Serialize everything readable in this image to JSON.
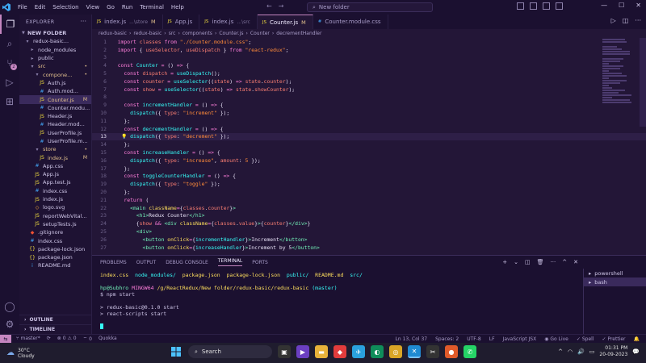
{
  "titlebar": {
    "menu": [
      "File",
      "Edit",
      "Selection",
      "View",
      "Go",
      "Run",
      "Terminal",
      "Help"
    ],
    "search": "New folder"
  },
  "sidebar": {
    "header": "EXPLORER",
    "root": "NEW FOLDER",
    "items": [
      {
        "label": "redux-basic...",
        "indent": 1,
        "type": "folder-open",
        "mark": "",
        "cls": ""
      },
      {
        "label": "node_modules",
        "indent": 2,
        "type": "folder",
        "mark": "",
        "cls": ""
      },
      {
        "label": "public",
        "indent": 2,
        "type": "folder",
        "mark": "",
        "cls": ""
      },
      {
        "label": "src",
        "indent": 2,
        "type": "folder-open",
        "mark": "•",
        "cls": "mod"
      },
      {
        "label": "compone...",
        "indent": 3,
        "type": "folder-open",
        "mark": "•",
        "cls": "mod"
      },
      {
        "label": "Auth.js",
        "indent": 4,
        "type": "js",
        "mark": "",
        "cls": ""
      },
      {
        "label": "Auth.mod...",
        "indent": 4,
        "type": "css",
        "mark": "",
        "cls": ""
      },
      {
        "label": "Counter.js",
        "indent": 4,
        "type": "js",
        "mark": "M",
        "cls": "mod"
      },
      {
        "label": "Counter.modu...",
        "indent": 4,
        "type": "css",
        "mark": "",
        "cls": ""
      },
      {
        "label": "Header.js",
        "indent": 4,
        "type": "js",
        "mark": "",
        "cls": ""
      },
      {
        "label": "Header.mod...",
        "indent": 4,
        "type": "css",
        "mark": "",
        "cls": ""
      },
      {
        "label": "UserProfile.js",
        "indent": 4,
        "type": "js",
        "mark": "",
        "cls": ""
      },
      {
        "label": "UserProfile.m...",
        "indent": 4,
        "type": "css",
        "mark": "",
        "cls": ""
      },
      {
        "label": "store",
        "indent": 3,
        "type": "folder-open",
        "mark": "•",
        "cls": "mod"
      },
      {
        "label": "index.js",
        "indent": 4,
        "type": "js",
        "mark": "M",
        "cls": "mod"
      },
      {
        "label": "App.css",
        "indent": 3,
        "type": "css",
        "mark": "",
        "cls": ""
      },
      {
        "label": "App.js",
        "indent": 3,
        "type": "js",
        "mark": "",
        "cls": ""
      },
      {
        "label": "App.test.js",
        "indent": 3,
        "type": "js",
        "mark": "",
        "cls": ""
      },
      {
        "label": "index.css",
        "indent": 3,
        "type": "css",
        "mark": "",
        "cls": ""
      },
      {
        "label": "index.js",
        "indent": 3,
        "type": "js",
        "mark": "",
        "cls": ""
      },
      {
        "label": "logo.svg",
        "indent": 3,
        "type": "svg",
        "mark": "",
        "cls": ""
      },
      {
        "label": "reportWebVital...",
        "indent": 3,
        "type": "js",
        "mark": "",
        "cls": ""
      },
      {
        "label": "setupTests.js",
        "indent": 3,
        "type": "js",
        "mark": "",
        "cls": ""
      },
      {
        "label": ".gitignore",
        "indent": 2,
        "type": "git",
        "mark": "",
        "cls": ""
      },
      {
        "label": "index.css",
        "indent": 2,
        "type": "css",
        "mark": "",
        "cls": ""
      },
      {
        "label": "package-lock.json",
        "indent": 2,
        "type": "json",
        "mark": "",
        "cls": ""
      },
      {
        "label": "package.json",
        "indent": 2,
        "type": "json",
        "mark": "",
        "cls": ""
      },
      {
        "label": "README.md",
        "indent": 2,
        "type": "md",
        "mark": "",
        "cls": ""
      }
    ],
    "outline": "OUTLINE",
    "timeline": "TIMELINE"
  },
  "tabs": [
    {
      "name": "index.js",
      "hint": "...\\store",
      "mod": "M",
      "active": false,
      "icon": "js"
    },
    {
      "name": "App.js",
      "hint": "",
      "mod": "",
      "active": false,
      "icon": "js"
    },
    {
      "name": "index.js",
      "hint": "...\\src",
      "mod": "",
      "active": false,
      "icon": "js"
    },
    {
      "name": "Counter.js",
      "hint": "",
      "mod": "M",
      "active": true,
      "icon": "js"
    },
    {
      "name": "Counter.module.css",
      "hint": "",
      "mod": "",
      "active": false,
      "icon": "css"
    }
  ],
  "breadcrumb": [
    "redux-basic",
    "redux-basic",
    "src",
    "components",
    "Counter.js",
    "Counter",
    "decrementHandler"
  ],
  "code": [
    {
      "n": 1,
      "h": "<span class='k'>import</span> <span class='v'>classes</span> <span class='k'>from</span> <span class='s'>\"./Counter.module.css\"</span>;"
    },
    {
      "n": 2,
      "h": "<span class='k'>import</span> { <span class='v'>useSelector</span>, <span class='v'>useDispatch</span> } <span class='k'>from</span> <span class='s'>\"react-redux\"</span>;"
    },
    {
      "n": 3,
      "h": ""
    },
    {
      "n": 4,
      "h": "<span class='k'>const</span> <span class='f'>Counter</span> <span class='k'>=</span> () <span class='k'>=></span> {"
    },
    {
      "n": 5,
      "h": "  <span class='k'>const</span> <span class='v'>dispatch</span> <span class='k'>=</span> <span class='f'>useDispatch</span>();"
    },
    {
      "n": 6,
      "h": "  <span class='k'>const</span> <span class='v'>counter</span> <span class='k'>=</span> <span class='f'>useSelector</span>((<span class='v'>state</span>) <span class='k'>=></span> <span class='v'>state</span>.<span class='v'>counter</span>);"
    },
    {
      "n": 7,
      "h": "  <span class='k'>const</span> <span class='v'>show</span> <span class='k'>=</span> <span class='f'>useSelector</span>((<span class='v'>state</span>) <span class='k'>=></span> <span class='v'>state</span>.<span class='v'>showCounter</span>);"
    },
    {
      "n": 8,
      "h": ""
    },
    {
      "n": 9,
      "h": "  <span class='k'>const</span> <span class='f'>incrementHandler</span> <span class='k'>=</span> () <span class='k'>=></span> {"
    },
    {
      "n": 10,
      "h": "    <span class='f'>dispatch</span>({ <span class='v'>type</span>: <span class='s'>\"increment\"</span> });"
    },
    {
      "n": 11,
      "h": "  };"
    },
    {
      "n": 12,
      "h": "  <span class='k'>const</span> <span class='f'>decrementHandler</span> <span class='k'>=</span> () <span class='k'>=></span> {"
    },
    {
      "n": 13,
      "h": "    <span class='f'>dispatch</span>({ <span class='v'>type</span>: <span class='s'>\"decrement\"</span> });"
    },
    {
      "n": 14,
      "h": "  };"
    },
    {
      "n": 15,
      "h": "  <span class='k'>const</span> <span class='f'>increaseHandler</span> <span class='k'>=</span> () <span class='k'>=></span> {"
    },
    {
      "n": 16,
      "h": "    <span class='f'>dispatch</span>({ <span class='v'>type</span>: <span class='s'>\"increase\"</span>, <span class='v'>amount</span>: <span class='s'>5</span> });"
    },
    {
      "n": 17,
      "h": "  };"
    },
    {
      "n": 18,
      "h": "  <span class='k'>const</span> <span class='f'>toggleCounterHandler</span> <span class='k'>=</span> () <span class='k'>=></span> {"
    },
    {
      "n": 19,
      "h": "    <span class='f'>dispatch</span>({ <span class='v'>type</span>: <span class='s'>\"toggle\"</span> });"
    },
    {
      "n": 20,
      "h": "  };"
    },
    {
      "n": 21,
      "h": "  <span class='k'>return</span> ("
    },
    {
      "n": 22,
      "h": "    <span class='t'>&lt;main</span> <span class='c'>className</span><span class='k'>=</span>{<span class='v'>classes</span>.<span class='v'>counter</span>}<span class='t'>&gt;</span>"
    },
    {
      "n": 23,
      "h": "      <span class='t'>&lt;h1&gt;</span>Redux Counter<span class='t'>&lt;/h1&gt;</span>"
    },
    {
      "n": 24,
      "h": "      {<span class='v'>show</span> <span class='k'>&amp;&amp;</span> <span class='t'>&lt;div</span> <span class='c'>className</span><span class='k'>=</span>{<span class='v'>classes</span>.<span class='v'>value</span>}<span class='t'>&gt;</span>{<span class='v'>counter</span>}<span class='t'>&lt;/div&gt;</span>}"
    },
    {
      "n": 25,
      "h": "      <span class='t'>&lt;div&gt;</span>"
    },
    {
      "n": 26,
      "h": "        <span class='t'>&lt;button</span> <span class='c'>onClick</span><span class='k'>=</span>{<span class='f'>incrementHandler</span>}<span class='t'>&gt;</span>Increment<span class='t'>&lt;/button&gt;</span>"
    },
    {
      "n": 27,
      "h": "        <span class='t'>&lt;button</span> <span class='c'>onClick</span><span class='k'>=</span>{<span class='f'>increaseHandler</span>}<span class='t'>&gt;</span>Increment by 5<span class='t'>&lt;/button&gt;</span>"
    }
  ],
  "current_line": 13,
  "panel": {
    "tabs": [
      "PROBLEMS",
      "OUTPUT",
      "DEBUG CONSOLE",
      "TERMINAL",
      "PORTS"
    ],
    "active_tab": "TERMINAL",
    "ls_line": [
      {
        "t": "index.css",
        "c": "t-file"
      },
      {
        "t": "node_modules/",
        "c": "t-dir"
      },
      {
        "t": "package.json",
        "c": "t-file"
      },
      {
        "t": "package-lock.json",
        "c": "t-file"
      },
      {
        "t": "public/",
        "c": "t-dir"
      },
      {
        "t": "README.md",
        "c": "t-file"
      },
      {
        "t": "src/",
        "c": "t-dir"
      }
    ],
    "prompt_user": "hp@Subhro",
    "prompt_host": "MINGW64",
    "prompt_path": "/g/ReactRedux/New folder/redux-basic/redux-basic",
    "prompt_branch": "(master)",
    "command": "$ npm start",
    "out1": "> redux-basic@0.1.0 start",
    "out2": "> react-scripts start",
    "shells": [
      "powershell",
      "bash"
    ]
  },
  "statusbar": {
    "branch": "master*",
    "sync": "",
    "errors": "0",
    "warnings": "0",
    "ports": "0",
    "quokka": "Quokka",
    "position": "Ln 13, Col 37",
    "spaces": "Spaces: 2",
    "encoding": "UTF-8",
    "eol": "LF",
    "language": "JavaScript JSX",
    "golive": "Go Live",
    "spell": "Spell",
    "prettier": "Prettier"
  },
  "taskbar": {
    "temp": "30°C",
    "weather": "Cloudy",
    "search": "Search",
    "lang": "ENG\nIN",
    "time": "01:31 PM",
    "date": "20-09-2023"
  },
  "colors": {
    "accent": "#c586c0",
    "bg": "#231637"
  }
}
